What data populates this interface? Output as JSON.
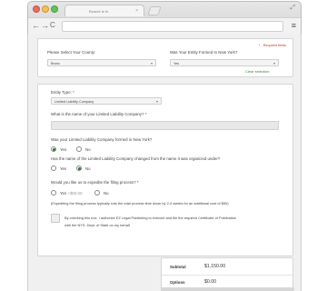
{
  "browser": {
    "tab_title": "Beaute le fe",
    "tab_close": "×",
    "nav": {
      "back": "←",
      "forward": "→",
      "reload": "C"
    },
    "menu_glyph": "≡",
    "expand_glyph": "⤢"
  },
  "location_card": {
    "required_note": "* - Required fields",
    "county_label": "Please Select Your County:",
    "county_value": "Bronx",
    "formed_label": "Was Your Entity Formed In New York?",
    "formed_value": "Yes",
    "clear_link": "Clear selection"
  },
  "entity_card": {
    "entity_type_label": "Entity Type: *",
    "entity_type_value": "Limited Liability Company",
    "name_label": "What is the name of your Limited Liability Company? *",
    "name_value": "",
    "formed_ny_question": "Was your Limited Liability Company formed in New York?",
    "formed_ny_options": [
      {
        "label": "Yes",
        "selected": true
      },
      {
        "label": "No",
        "selected": false
      }
    ],
    "name_changed_question": "Has the name of the Limited Liability Company changed from the name it was organized under?",
    "name_changed_options": [
      {
        "label": "Yes",
        "selected": false
      },
      {
        "label": "No",
        "selected": true
      }
    ],
    "expedite_question": "Would you like us to expedite the filing process? *",
    "expedite_options": [
      {
        "label": "Yes",
        "price": "+$50.00",
        "selected": false
      },
      {
        "label": "No",
        "selected": false
      }
    ],
    "expedite_note": "(Expediting the filing process typically cuts the total process time down by 2-4 weeks for an additional cost of $50)",
    "authorize_line1": "By checking this box, I authorize EZ Legal Publishing to execute and file the required Certificate of Publication",
    "authorize_line2": "with the NYS. Dept. of State on my behalf"
  },
  "summary": {
    "subtotal_label": "Subtotal",
    "subtotal_value": "$1,150.00",
    "options_label": "Options",
    "options_value": "$0.00"
  },
  "colors": {
    "accent_green": "#2e7d32",
    "link_green": "#2e8b2e",
    "required_red": "#c0392b"
  }
}
